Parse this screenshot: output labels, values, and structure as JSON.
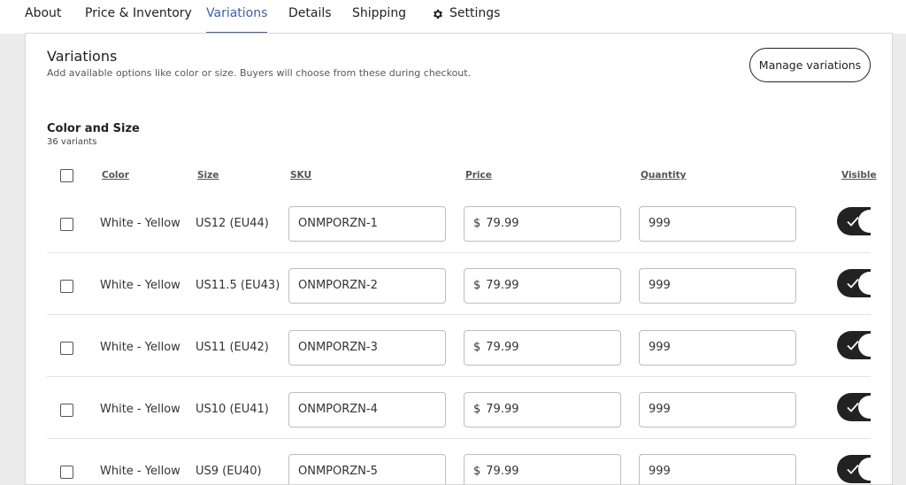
{
  "tabs": [
    {
      "label": "About"
    },
    {
      "label": "Price & Inventory"
    },
    {
      "label": "Variations",
      "active": true
    },
    {
      "label": "Details"
    },
    {
      "label": "Shipping"
    },
    {
      "label": "Settings",
      "icon": "gear-icon"
    }
  ],
  "section": {
    "title": "Variations",
    "description": "Add available options like color or size. Buyers will choose from these during checkout.",
    "manage_button": "Manage variations"
  },
  "group": {
    "title": "Color and Size",
    "count": "36 variants"
  },
  "columns": [
    "Color",
    "Size",
    "SKU",
    "Price",
    "Quantity",
    "Visible"
  ],
  "currency": "$",
  "rows": [
    {
      "color": "White - Yellow",
      "size": "US12 (EU44)",
      "sku": "ONMPORZN-1",
      "price": "79.99",
      "quantity": "999",
      "visible": true
    },
    {
      "color": "White - Yellow",
      "size": "US11.5 (EU43)",
      "sku": "ONMPORZN-2",
      "price": "79.99",
      "quantity": "999",
      "visible": true
    },
    {
      "color": "White - Yellow",
      "size": "US11 (EU42)",
      "sku": "ONMPORZN-3",
      "price": "79.99",
      "quantity": "999",
      "visible": true
    },
    {
      "color": "White - Yellow",
      "size": "US10 (EU41)",
      "sku": "ONMPORZN-4",
      "price": "79.99",
      "quantity": "999",
      "visible": true
    },
    {
      "color": "White - Yellow",
      "size": "US9 (EU40)",
      "sku": "ONMPORZN-5",
      "price": "79.99",
      "quantity": "999",
      "visible": true
    }
  ],
  "colors": {
    "accent": "#3f5eab",
    "toggle_on": "#222222"
  }
}
